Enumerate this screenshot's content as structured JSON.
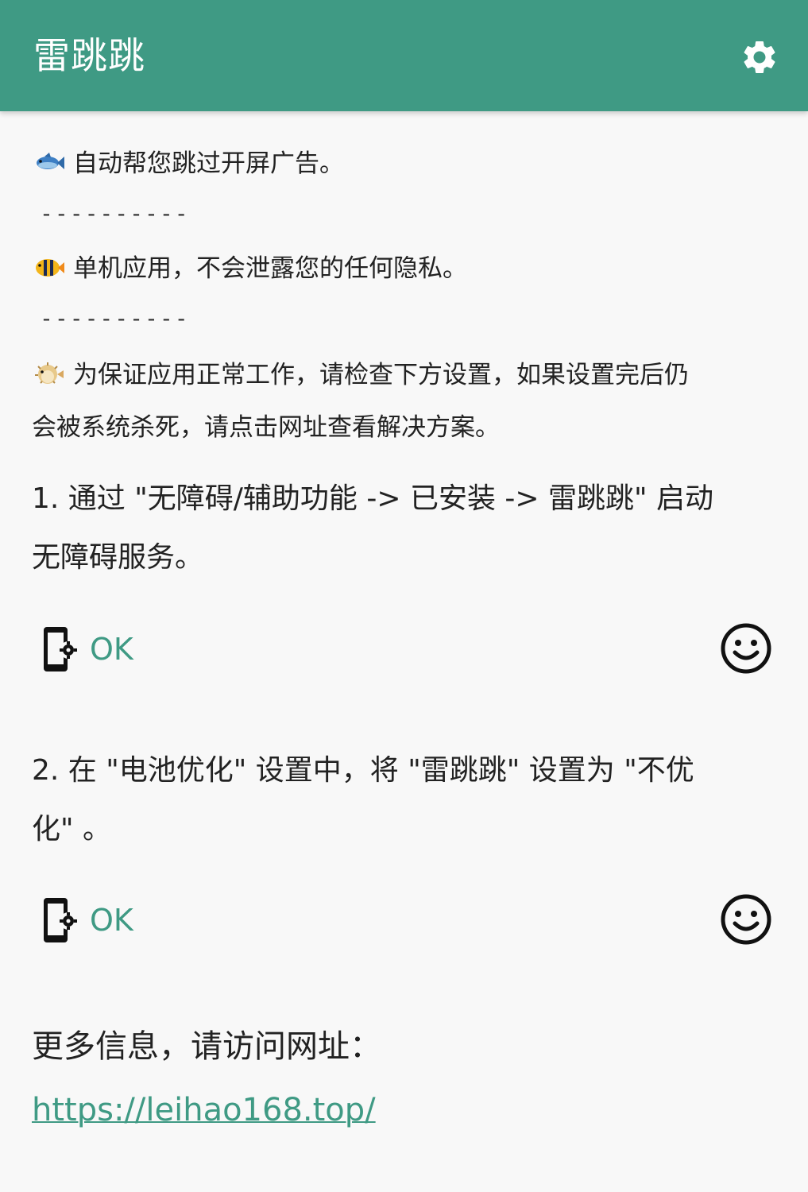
{
  "appbar": {
    "title": "雷跳跳",
    "settings_icon": "gear-icon"
  },
  "intro": {
    "line1": "自动帮您跳过开屏广告。",
    "separator1": "----------",
    "line2": "单机应用，不会泄露您的任何隐私。",
    "separator2": "----------",
    "line3a": "为保证应用正常工作，请检查下方设置，如果设置完后仍",
    "line3b": "会被系统杀死，请点击网址查看解决方案。"
  },
  "steps": [
    {
      "text_a": "1. 通过 \"无障碍/辅助功能 -> 已安装 -> 雷跳跳\" 启动",
      "text_b": "无障碍服务。",
      "status": "OK",
      "status_icon": "smiley-icon"
    },
    {
      "text_a": "2. 在 \"电池优化\" 设置中，将 \"雷跳跳\" 设置为 \"不优",
      "text_b": "化\" 。",
      "status": "OK",
      "status_icon": "smiley-icon"
    }
  ],
  "footer": {
    "more_info": "更多信息，请访问网址：",
    "url": "https://leihao168.top/"
  },
  "colors": {
    "accent": "#3f9a84",
    "background": "#f8f8f8",
    "text": "#222222"
  }
}
